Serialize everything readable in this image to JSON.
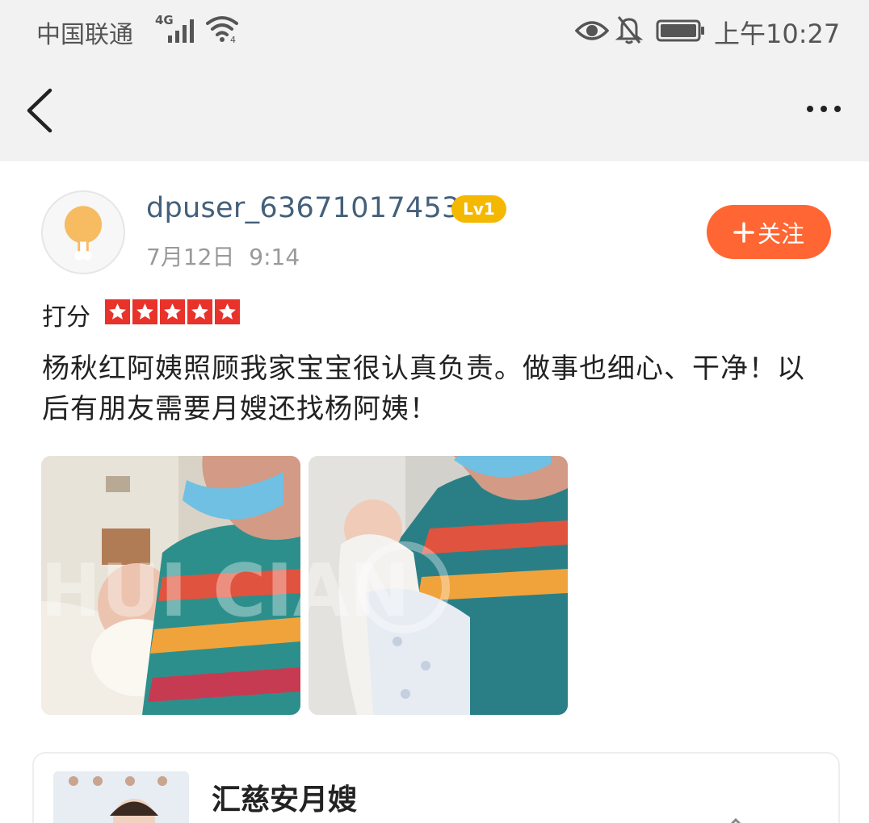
{
  "status_bar": {
    "carrier": "中国联通",
    "network_type": "4G",
    "time": "上午10:27",
    "icons": [
      "signal-icon",
      "wifi-icon",
      "eye-icon",
      "bell-muted-icon",
      "battery-icon"
    ]
  },
  "nav": {
    "back_icon": "back-arrow-icon",
    "more_icon": "more-dots-icon"
  },
  "review": {
    "username": "dpuser_63671017453",
    "level": "Lv1",
    "date": "7月12日",
    "time": "9:14",
    "follow_label": "关注",
    "rating_label": "打分",
    "rating": 5,
    "rating_max": 5,
    "text": "杨秋红阿姨照顾我家宝宝很认真负责。做事也细心、干净！以后有朋友需要月嫂还找杨阿姨！",
    "photo_count": 2
  },
  "shop": {
    "name": "汇慈安月嫂"
  },
  "colors": {
    "accent": "#ff6633",
    "star": "#e8322a",
    "badge": "#f5b800",
    "username": "#44607a",
    "bar_bg": "#f2f2f2"
  }
}
